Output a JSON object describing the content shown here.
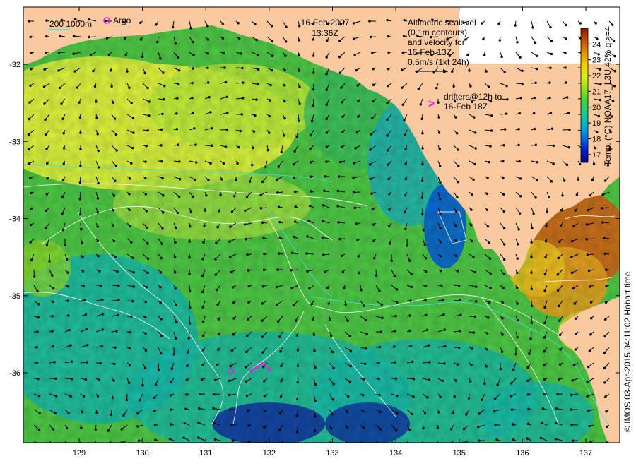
{
  "title": {
    "date": "16-Feb-2007",
    "time": "13:36Z"
  },
  "legend": {
    "isobath_label": "200  1000m",
    "argo_label": "Argo",
    "altimetry_lines": [
      "Altimetric sealevel",
      "(0.1m contours)",
      "and velocity for",
      "16-Feb 13Z",
      "0.5m/s (1kt 24h)"
    ],
    "drifter_symbol": ">",
    "drifter_lines": [
      "drifters@12h to",
      "16-Feb 18Z"
    ]
  },
  "colorbar": {
    "label": "Temp. (°C) NOAA17_L3U 42% ql>=4",
    "min": 16.5,
    "max": 25,
    "ticks": [
      "17",
      "18",
      "19",
      "20",
      "21",
      "22",
      "23",
      "24"
    ],
    "stops": [
      "#00007f",
      "#0020c0",
      "#0070e0",
      "#00b0d0",
      "#20c890",
      "#40d040",
      "#90e020",
      "#d8f020",
      "#f0d000",
      "#e09000",
      "#c05010",
      "#7a2000"
    ]
  },
  "credit": "© IMOS 03-Apr-2015 04:11:02 Hobart time",
  "axes": {
    "x_ticks": [
      "129",
      "130",
      "131",
      "132",
      "133",
      "134",
      "135",
      "136",
      "137"
    ],
    "y_ticks": [
      "-32",
      "-33",
      "-34",
      "-35",
      "-36"
    ],
    "lon_range": [
      128.2,
      137.5
    ],
    "lat_range": [
      -36.9,
      -31.5
    ]
  },
  "colors": {
    "land": "#fac9a0",
    "sea_warm": "#d8ee3c",
    "sea_mid": "#4cc444",
    "sea_cool": "#18b8a8",
    "sea_cold": "#1030a0",
    "contour": "#ffffff",
    "isobath": "#40e0e0",
    "argo": "#e020e0",
    "drifter": "#e020e0"
  },
  "argo_floats": [
    {
      "lon": 131.4,
      "lat": -35.98
    }
  ],
  "drifters": [
    {
      "lon": 131.7,
      "lat": -35.97
    },
    {
      "lon": 131.8,
      "lat": -35.92
    },
    {
      "lon": 131.9,
      "lat": -35.87
    },
    {
      "lon": 132.0,
      "lat": -35.95
    }
  ]
}
